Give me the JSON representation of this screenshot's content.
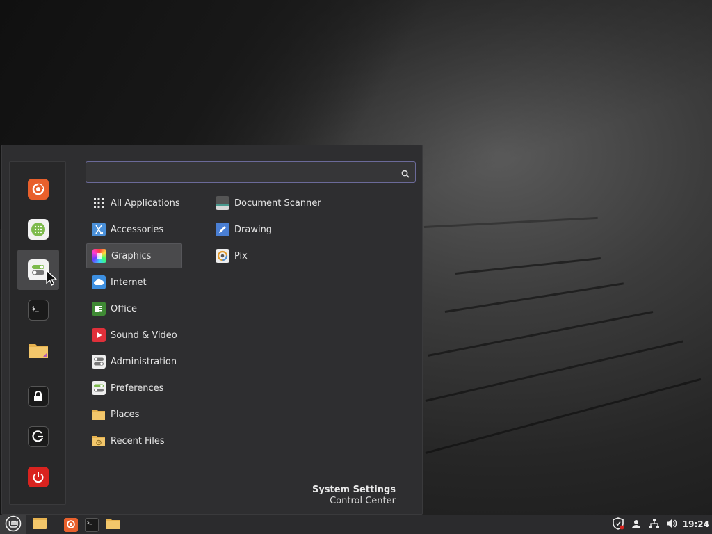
{
  "search": {
    "value": "",
    "placeholder": ""
  },
  "favorites": [
    {
      "name": "Firefox",
      "icon": "firefox-icon"
    },
    {
      "name": "Software Manager",
      "icon": "software-manager-icon"
    },
    {
      "name": "System Settings",
      "icon": "system-settings-icon"
    },
    {
      "name": "Terminal",
      "icon": "terminal-icon"
    },
    {
      "name": "Files",
      "icon": "folder-icon"
    },
    {
      "name": "Lock Screen",
      "icon": "lock-icon"
    },
    {
      "name": "Logout",
      "icon": "logout-icon"
    },
    {
      "name": "Quit",
      "icon": "power-icon"
    }
  ],
  "categories": [
    {
      "label": "All Applications",
      "icon": "grid-icon"
    },
    {
      "label": "Accessories",
      "icon": "scissors-icon"
    },
    {
      "label": "Graphics",
      "icon": "graphics-icon",
      "selected": true
    },
    {
      "label": "Internet",
      "icon": "cloud-icon"
    },
    {
      "label": "Office",
      "icon": "office-icon"
    },
    {
      "label": "Sound & Video",
      "icon": "play-icon"
    },
    {
      "label": "Administration",
      "icon": "toggles-icon"
    },
    {
      "label": "Preferences",
      "icon": "preferences-icon"
    },
    {
      "label": "Places",
      "icon": "folder-icon"
    },
    {
      "label": "Recent Files",
      "icon": "recent-folder-icon"
    }
  ],
  "apps": [
    {
      "label": "Document Scanner",
      "icon": "scanner-icon"
    },
    {
      "label": "Drawing",
      "icon": "drawing-icon"
    },
    {
      "label": "Pix",
      "icon": "pix-icon"
    }
  ],
  "description": {
    "title": "System Settings",
    "subtitle": "Control Center"
  },
  "panel": {
    "launchers": [
      "files-icon",
      "firefox-icon",
      "terminal-icon",
      "folder-icon"
    ],
    "tray": [
      "shield-icon",
      "user-icon",
      "network-icon",
      "volume-icon"
    ],
    "clock": "19:24"
  },
  "colors": {
    "accent": "#6b6a99",
    "firefox": "#e8602c",
    "power": "#d9231f",
    "folder": "#f3c76b"
  }
}
